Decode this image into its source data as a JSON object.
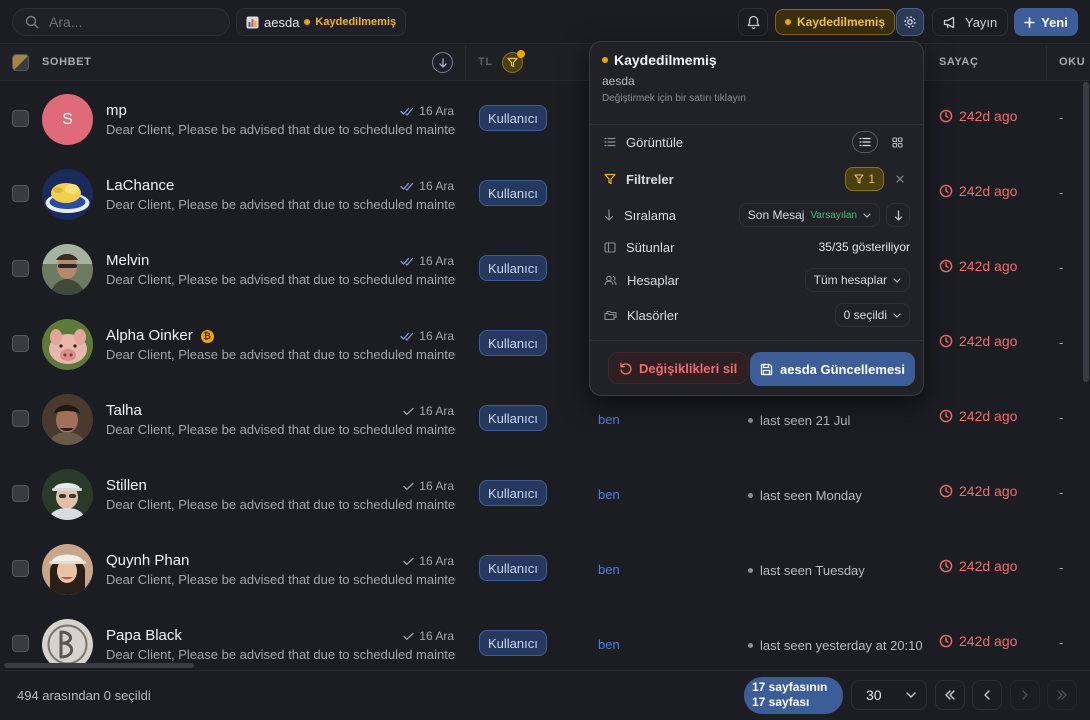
{
  "search": {
    "placeholder": "Ara..."
  },
  "view": {
    "name": "aesda",
    "status": "Kaydedilmemiş"
  },
  "topbar": {
    "unsaved_label": "Kaydedilmemiş",
    "publish_label": "Yayın",
    "new_label": "Yeni"
  },
  "table": {
    "headers": {
      "chat": "SOHBET",
      "type": "TL",
      "counter": "SAYAÇ",
      "read": "OKU"
    },
    "rows": [
      {
        "name": "mp",
        "avatar": "S",
        "preview": "Dear Client, Please be advised that due to scheduled maintenance",
        "date": "16 Ara",
        "read": true,
        "type": "Kullanıcı",
        "owner": "",
        "seen": "",
        "counter": "242d ago",
        "dash": "-"
      },
      {
        "name": "LaChance",
        "preview": "Dear Client, Please be advised that due to scheduled maintenance",
        "date": "16 Ara",
        "read": true,
        "type": "Kullanıcı",
        "owner": "",
        "seen": "",
        "counter": "242d ago",
        "dash": "-"
      },
      {
        "name": "Melvin",
        "preview": "Dear Client, Please be advised that due to scheduled maintenance",
        "date": "16 Ara",
        "read": true,
        "type": "Kullanıcı",
        "owner": "",
        "seen": "",
        "counter": "242d ago",
        "dash": "-"
      },
      {
        "name": "Alpha Oinker",
        "badge": "₿",
        "preview": "Dear Client, Please be advised that due to scheduled maintenance",
        "date": "16 Ara",
        "read": true,
        "type": "Kullanıcı",
        "owner": "",
        "seen": "",
        "counter": "242d ago",
        "dash": "-"
      },
      {
        "name": "Talha",
        "preview": "Dear Client, Please be advised that due to scheduled maintenance",
        "date": "16 Ara",
        "read": false,
        "type": "Kullanıcı",
        "owner": "ben",
        "seen": "last seen 21 Jul",
        "counter": "242d ago",
        "dash": "-"
      },
      {
        "name": "Stillen",
        "preview": "Dear Client, Please be advised that due to scheduled maintenance",
        "date": "16 Ara",
        "read": false,
        "type": "Kullanıcı",
        "owner": "ben",
        "seen": "last seen Monday",
        "counter": "242d ago",
        "dash": "-"
      },
      {
        "name": "Quynh Phan",
        "preview": "Dear Client, Please be advised that due to scheduled maintenance",
        "date": "16 Ara",
        "read": false,
        "type": "Kullanıcı",
        "owner": "ben",
        "seen": "last seen Tuesday",
        "counter": "242d ago",
        "dash": "-"
      },
      {
        "name": "Papa Black",
        "preview": "Dear Client, Please be advised that due to scheduled maintenance",
        "date": "16 Ara",
        "read": false,
        "type": "Kullanıcı",
        "owner": "ben",
        "seen": "last seen yesterday at 20:10",
        "counter": "242d ago",
        "dash": "-"
      }
    ]
  },
  "footer": {
    "selection": "494 arasından 0 seçildi",
    "page_line1": "17 sayfasının",
    "page_line2": "17 sayfası",
    "page_size": "30"
  },
  "popover": {
    "title": "Kaydedilmemiş",
    "view_name": "aesda",
    "hint": "Değiştirmek için bir satırı tıklayın",
    "view_label": "Görüntüle",
    "filters_label": "Filtreler",
    "filters_count": "1",
    "sort_label": "Sıralama",
    "sort_value": "Son Mesaj",
    "sort_default": "Varsayılan",
    "columns_label": "Sütunlar",
    "columns_value": "35/35 gösteriliyor",
    "accounts_label": "Hesaplar",
    "accounts_value": "Tüm hesaplar",
    "folders_label": "Klasörler",
    "folders_value": "0 seçildi",
    "discard_label": "Değişiklikleri sil",
    "update_label": "aesda Güncellemesi"
  },
  "colors": {
    "accent": "#3d5d99",
    "warning": "#f2a400",
    "danger": "#f06b6b",
    "link": "#4d7fe0"
  }
}
